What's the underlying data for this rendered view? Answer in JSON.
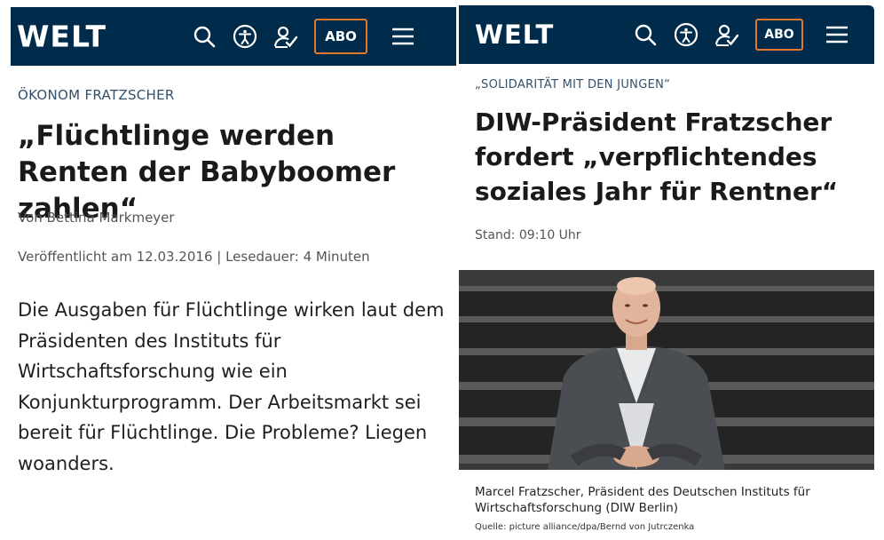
{
  "left": {
    "logo": "WELT",
    "abo_label": "ABO",
    "kicker": "ÖKONOM FRATZSCHER",
    "headline": "„Flüchtlinge werden Renten der Babyboomer zahlen“",
    "author": "Von Bettina Markmeyer",
    "published": "Veröffentlicht am 12.03.2016  |  Lesedauer: 4 Minuten",
    "teaser": "Die Ausgaben für Flüchtlinge wirken laut dem Präsidenten des Instituts für Wirtschaftsforschung wie ein Konjunkturprogramm. Der Arbeitsmarkt sei bereit für Flüchtlinge. Die Probleme? Liegen woanders."
  },
  "right": {
    "logo": "WELT",
    "abo_label": "ABO",
    "kicker": "„SOLIDARITÄT MIT DEN JUNGEN“",
    "headline": "DIW-Präsident Fratzscher fordert „verpflichtendes soziales Jahr für Rentner“",
    "stand": "Stand: 09:10 Uhr",
    "caption": "Marcel Fratzscher, Präsident des Deutschen Instituts für Wirtschaftsforschung (DIW Berlin)",
    "credit": "Quelle: picture alliance/dpa/Bernd von Jutrczenka"
  },
  "icons": [
    "search-icon",
    "accessibility-icon",
    "user-login-icon",
    "menu-icon"
  ],
  "colors": {
    "header_bg": "#002b4a",
    "abo_border": "#e07a2e",
    "kicker": "#33506b"
  }
}
